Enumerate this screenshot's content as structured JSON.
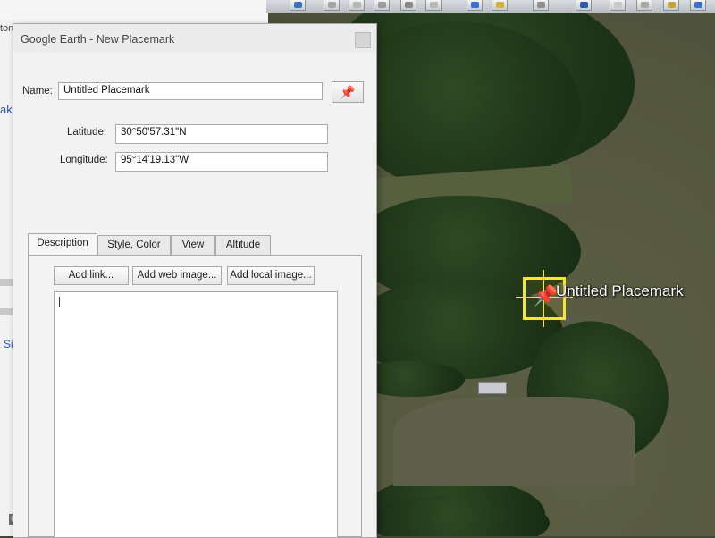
{
  "background_window": {
    "fragment_top": "ton",
    "fragment_link": "ake",
    "fragment_sig": "Sig",
    "fragment_bottom": "Un"
  },
  "toolbar": {
    "buttons": [
      "sidebar-icon",
      "hand-icon",
      "polygon-icon",
      "path-icon",
      "overlay-icon",
      "tour-icon",
      "sun-icon",
      "history-icon",
      "planets-icon",
      "ruler-icon",
      "email-icon",
      "print-icon",
      "save-image-icon"
    ]
  },
  "dialog": {
    "title": "Google Earth - New Placemark",
    "name_label": "Name:",
    "name_value": "Untitled Placemark",
    "latitude_label": "Latitude:",
    "latitude_value": "30°50'57.31\"N",
    "longitude_label": "Longitude:",
    "longitude_value": "95°14'19.13\"W",
    "tabs": [
      "Description",
      "Style, Color",
      "View",
      "Altitude"
    ],
    "active_tab": "Description",
    "buttons": {
      "add_link": "Add link...",
      "add_web_image": "Add web image...",
      "add_local_image": "Add local image..."
    },
    "description_value": ""
  },
  "map": {
    "placemark_label": "Untitled Placemark",
    "placemark_color": "#f0e92e"
  }
}
